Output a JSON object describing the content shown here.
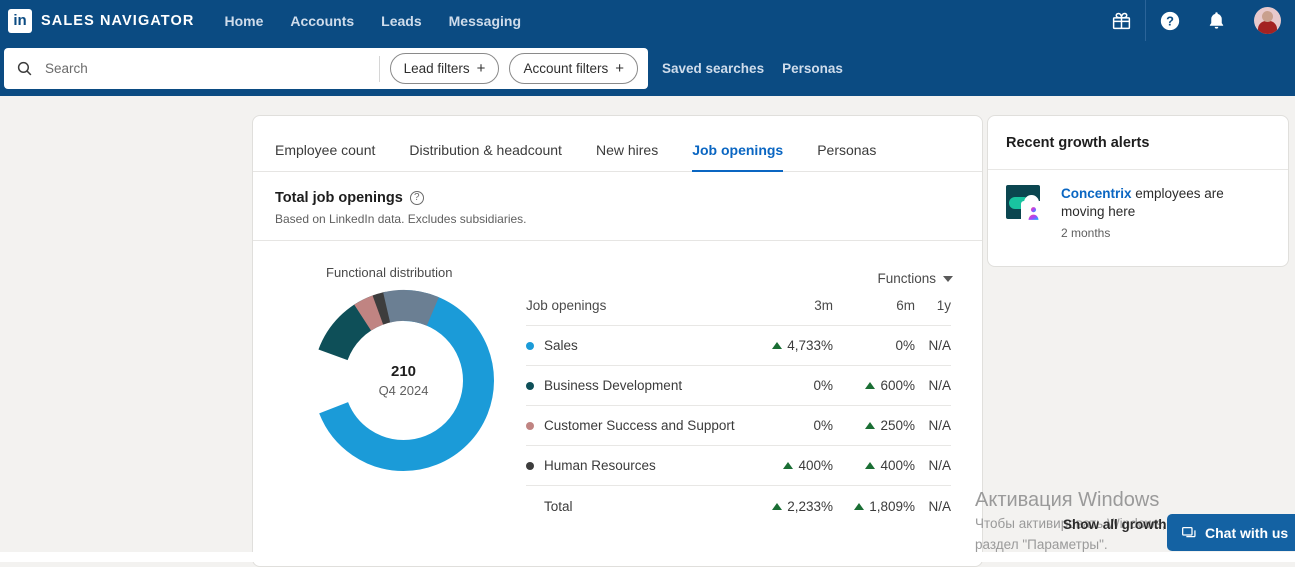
{
  "topnav": {
    "logo_letters": "in",
    "brand": "SALES NAVIGATOR",
    "links": [
      {
        "label": "Home"
      },
      {
        "label": "Accounts"
      },
      {
        "label": "Leads"
      },
      {
        "label": "Messaging"
      }
    ],
    "icons": [
      {
        "name": "gift-icon"
      },
      {
        "name": "help-icon"
      },
      {
        "name": "notifications-bell-icon"
      }
    ]
  },
  "search": {
    "placeholder": "Search",
    "value": "",
    "lead_filters": "Lead filters",
    "account_filters": "Account filters",
    "plus": "+",
    "saved_searches": "Saved searches",
    "personas": "Personas"
  },
  "tabs": [
    {
      "label": "Employee count",
      "active": false
    },
    {
      "label": "Distribution & headcount",
      "active": false
    },
    {
      "label": "New hires",
      "active": false
    },
    {
      "label": "Job openings",
      "active": true
    },
    {
      "label": "Personas",
      "active": false
    }
  ],
  "card": {
    "title": "Total job openings",
    "subtitle": "Based on LinkedIn data. Excludes subsidiaries.",
    "help_glyph": "?",
    "functional_distribution_label": "Functional distribution",
    "functions_dropdown": "Functions"
  },
  "chart_data": {
    "type": "pie",
    "title": "Functional distribution",
    "center_value": "210",
    "center_period": "Q4 2024",
    "total_openings": 210,
    "categories": [
      "Sales",
      "Business Development",
      "Customer Success and Support",
      "Human Resources"
    ],
    "values": [
      145,
      29,
      10,
      5
    ],
    "other_value": 21,
    "colors": [
      "#1b9bd8",
      "#0e4f58",
      "#c08482",
      "#3d3d3d",
      "#6b7f93"
    ],
    "legend_position": "right-table",
    "grid": false
  },
  "table": {
    "columns": [
      "Job openings",
      "3m",
      "6m",
      "1y"
    ],
    "rows": [
      {
        "name": "Sales",
        "color": "#1b9bd8",
        "m3": "4,733%",
        "m3_up": true,
        "m6": "0%",
        "m6_up": false,
        "y1": "N/A"
      },
      {
        "name": "Business Development",
        "color": "#0e4f58",
        "m3": "0%",
        "m3_up": false,
        "m6": "600%",
        "m6_up": true,
        "y1": "N/A"
      },
      {
        "name": "Customer Success and Support",
        "color": "#c08482",
        "m3": "0%",
        "m3_up": false,
        "m6": "250%",
        "m6_up": true,
        "y1": "N/A"
      },
      {
        "name": "Human Resources",
        "color": "#3d3d3d",
        "m3": "400%",
        "m3_up": true,
        "m6": "400%",
        "m6_up": true,
        "y1": "N/A"
      }
    ],
    "total": {
      "name": "Total",
      "m3": "2,233%",
      "m3_up": true,
      "m6": "1,809%",
      "m6_up": true,
      "y1": "N/A"
    }
  },
  "rail": {
    "title": "Recent growth alerts",
    "alert": {
      "company": "Concentrix",
      "text": " employees are moving here",
      "time": "2 months",
      "logo_letter": "c"
    }
  },
  "footer": {
    "show_all_growth": "Show all growth",
    "chat_label": "Chat with us"
  },
  "watermark": {
    "title": "Активация Windows",
    "line1": "Чтобы активировать Windows, перейдите в",
    "line2": "раздел \"Параметры\"."
  }
}
